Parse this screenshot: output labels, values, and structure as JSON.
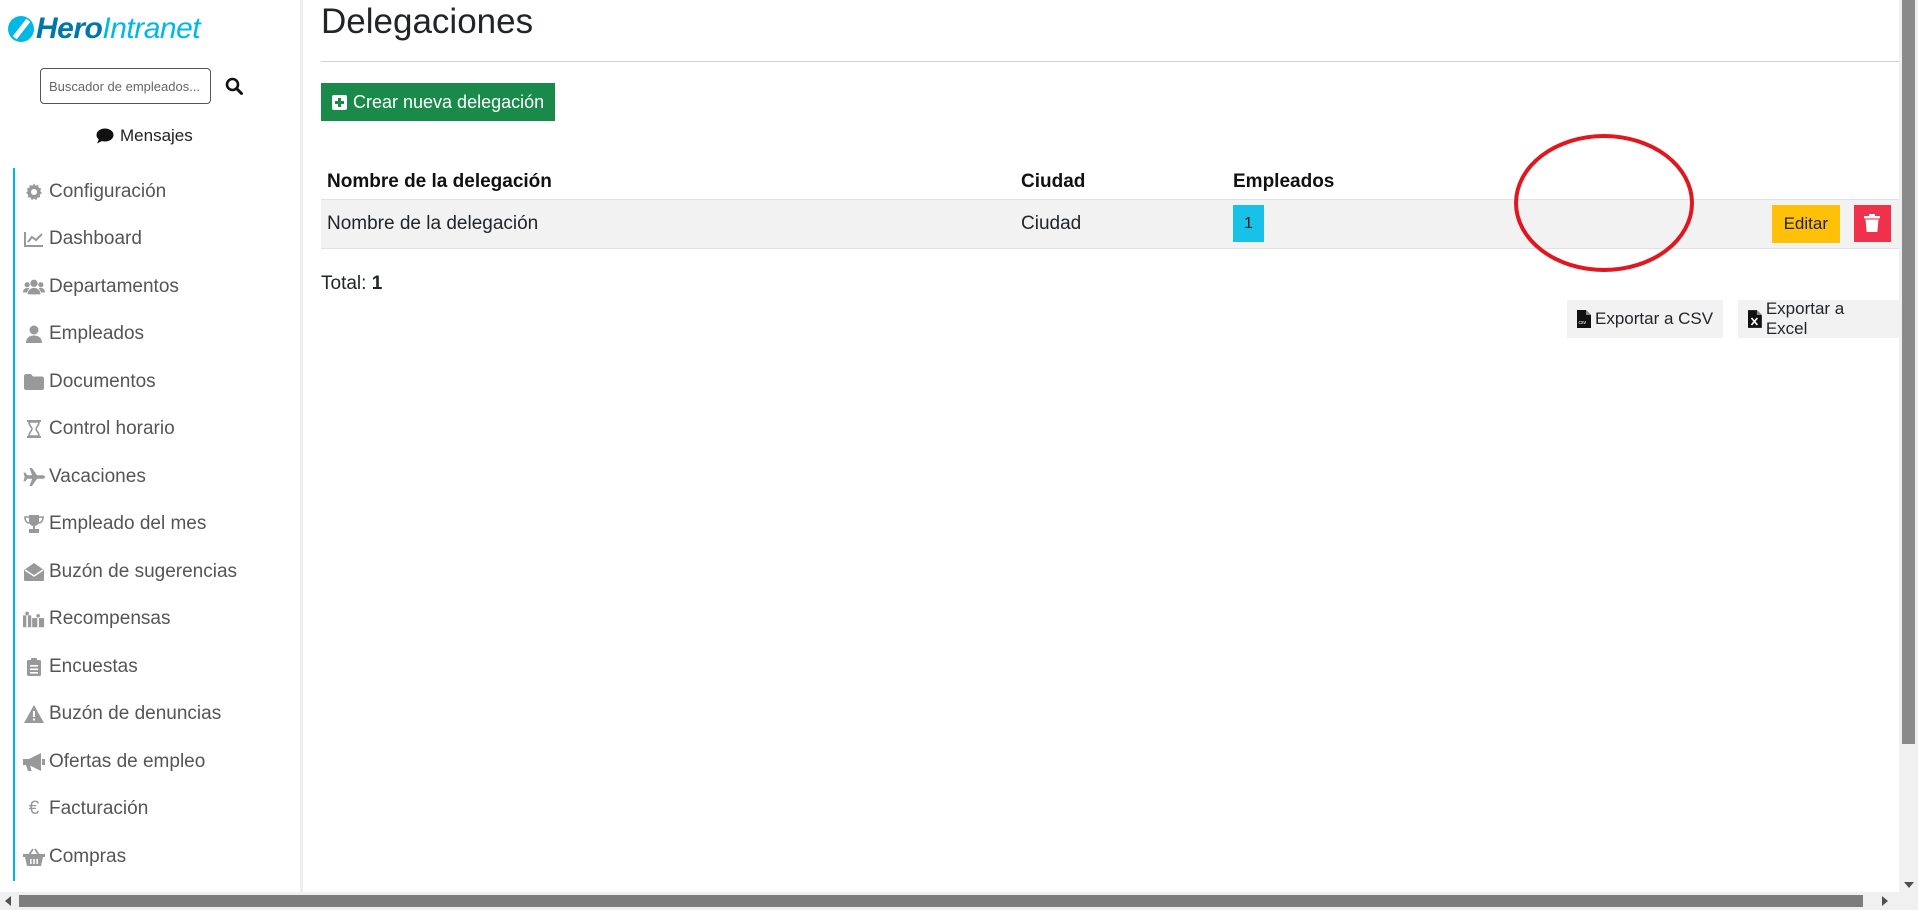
{
  "logo": {
    "brand_main": "Hero",
    "brand_accent": "Intranet"
  },
  "search": {
    "placeholder": "Buscador de empleados..."
  },
  "messages": {
    "label": "Mensajes"
  },
  "sidebar": {
    "items": [
      {
        "label": "Configuración",
        "icon": "gear-icon"
      },
      {
        "label": "Dashboard",
        "icon": "chart-line-icon"
      },
      {
        "label": "Departamentos",
        "icon": "users-icon"
      },
      {
        "label": "Empleados",
        "icon": "user-icon"
      },
      {
        "label": "Documentos",
        "icon": "folder-icon"
      },
      {
        "label": "Control horario",
        "icon": "hourglass-icon"
      },
      {
        "label": "Vacaciones",
        "icon": "plane-icon"
      },
      {
        "label": "Empleado del mes",
        "icon": "trophy-icon"
      },
      {
        "label": "Buzón de sugerencias",
        "icon": "envelope-open-icon"
      },
      {
        "label": "Recompensas",
        "icon": "gifts-icon"
      },
      {
        "label": "Encuestas",
        "icon": "clipboard-list-icon"
      },
      {
        "label": "Buzón de denuncias",
        "icon": "warning-icon"
      },
      {
        "label": "Ofertas de empleo",
        "icon": "bullhorn-icon"
      },
      {
        "label": "Facturación",
        "icon": "euro-icon"
      },
      {
        "label": "Compras",
        "icon": "basket-icon"
      }
    ]
  },
  "page": {
    "title": "Delegaciones",
    "create_button": "Crear nueva delegación"
  },
  "table": {
    "headers": {
      "name": "Nombre de la delegación",
      "city": "Ciudad",
      "employees": "Empleados"
    },
    "rows": [
      {
        "name": "Nombre de la delegación",
        "city": "Ciudad",
        "employees": "1",
        "edit": "Editar"
      }
    ]
  },
  "total": {
    "label": "Total:",
    "value": "1"
  },
  "export": {
    "csv": "Exportar a CSV",
    "excel": "Exportar a Excel"
  },
  "colors": {
    "brand": "#00b8e6",
    "create_button": "#1a8a4a",
    "badge": "#17c1e8",
    "edit_button": "#ffc107",
    "delete_button": "#f0314b",
    "annotation_circle": "#e0171f"
  }
}
